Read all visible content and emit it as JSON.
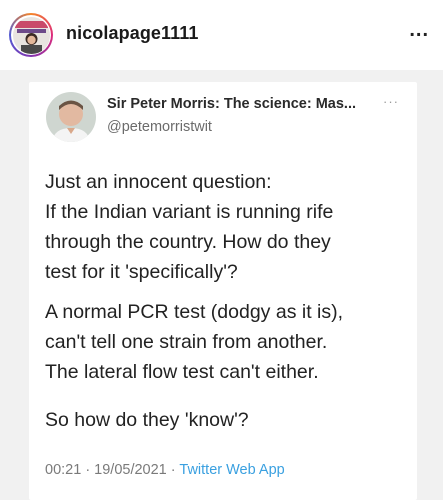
{
  "post": {
    "username": "nicolapage1111",
    "more_label": "..."
  },
  "tweet": {
    "display_name": "Sir Peter Morris: The science: Mas...",
    "handle": "@petemorristwit",
    "more_label": "···",
    "paragraphs": [
      [
        "Just an innocent question:",
        "If the Indian variant is running rife",
        "through the country. How do they",
        "test for it 'specifically'?"
      ],
      [
        "A normal PCR test (dodgy as it is),",
        "can't tell one strain from another.",
        "The lateral flow test can't either."
      ],
      [
        "So how do they 'know'?"
      ]
    ],
    "timestamp": "00:21 · 19/05/2021 ·",
    "source": "Twitter Web App"
  },
  "colors": {
    "link": "#3aa0e0",
    "background": "#f1f1f1"
  }
}
